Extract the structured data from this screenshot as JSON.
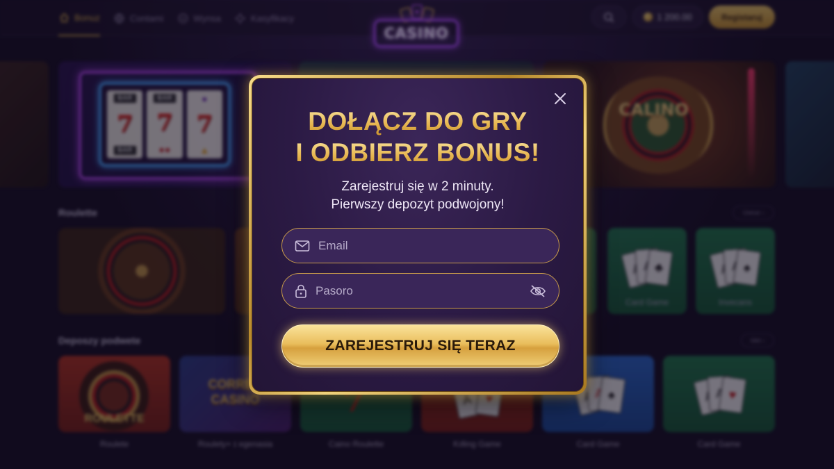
{
  "nav": {
    "items": [
      {
        "label": "Bonuz",
        "icon": "home-icon"
      },
      {
        "label": "Contami",
        "icon": "globe-icon"
      },
      {
        "label": "Wynsa",
        "icon": "chevron-circle-icon"
      },
      {
        "label": "Kasyfikacy",
        "icon": "puzzle-icon"
      }
    ]
  },
  "logo": {
    "text": "CASINO"
  },
  "header": {
    "balance": "1 200.00",
    "register_label": "Registaruj",
    "search_icon": "search-icon"
  },
  "banners": {
    "slot_reels": [
      "BAR",
      "777",
      "BAR"
    ],
    "roulette_text": "CALINO"
  },
  "sections": {
    "roulette": {
      "title": "Roulette",
      "more_label": "Uwiue",
      "tiles": [
        {
          "label": ""
        },
        {
          "label": ""
        },
        {
          "label": "Card Game"
        },
        {
          "label": "Invecans"
        }
      ]
    },
    "deposit": {
      "title": "Deposzy podwete",
      "more_label": "Idet",
      "tiles": [
        {
          "label": "Roulete",
          "art_text": "ROULETTE"
        },
        {
          "label": "Roulety+ ɪ egenasia",
          "art_text": "CORREN CASINO"
        },
        {
          "label": "Caino Roulette"
        },
        {
          "label": "Kılling Game"
        },
        {
          "label": "Card Game"
        },
        {
          "label": "Card Game"
        }
      ]
    }
  },
  "modal": {
    "title_line1": "DOŁĄCZ DO GRY",
    "title_line2": "I ODBIERZ BONUS!",
    "subtitle_line1": "Zarejestruj się w 2 minuty.",
    "subtitle_line2": "Pierwszy depozyt podwojony!",
    "email_placeholder": "Email",
    "password_placeholder": "Pasoro",
    "cta_label": "ZAREJESTRUJ SIĘ TERAZ"
  },
  "colors": {
    "gold": "#e7b94e",
    "background": "#140d22",
    "modal": "#2b1a44",
    "neon_purple": "#b04bff"
  }
}
